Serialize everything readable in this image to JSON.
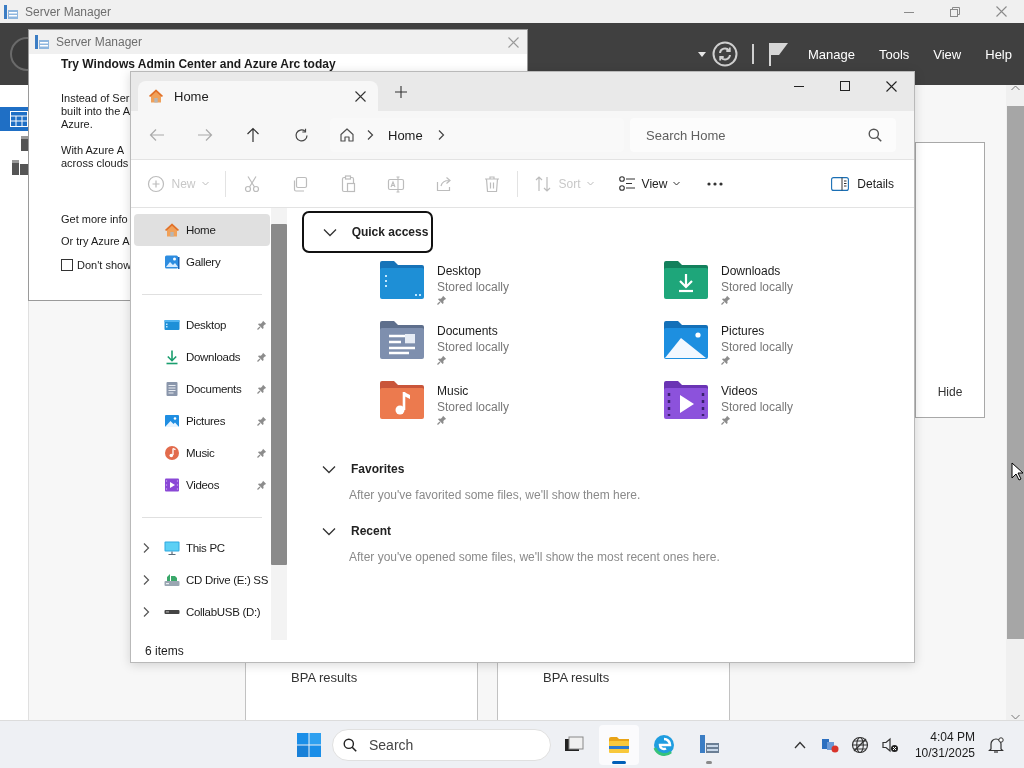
{
  "server_manager": {
    "title": "Server Manager",
    "menu": [
      "Manage",
      "Tools",
      "View",
      "Help"
    ],
    "sidebar": [
      {
        "kind": "dashboard",
        "selected": true
      },
      {
        "kind": "local_server",
        "selected": false
      },
      {
        "kind": "all_servers",
        "selected": false
      }
    ],
    "panel_link": "Hide",
    "tiles": [
      "BPA results",
      "BPA results"
    ]
  },
  "dialog": {
    "title": "Server Manager",
    "heading": "Try Windows Admin Center and Azure Arc today",
    "paragraphs": [
      [
        "Instead of Ser",
        "built into the A",
        "Azure."
      ],
      [
        "With Azure A",
        "across clouds"
      ]
    ],
    "links": [
      "Get more info",
      "Or try Azure A"
    ],
    "checkbox": {
      "label": "Don't show",
      "checked": false
    }
  },
  "explorer": {
    "tabs": [
      {
        "label": "Home",
        "selected": true
      }
    ],
    "breadcrumb": [
      "Home"
    ],
    "search": {
      "placeholder": "Search Home"
    },
    "toolbar": [
      {
        "kind": "new",
        "label": "New",
        "disabled": true
      },
      {
        "kind": "cut",
        "disabled": true
      },
      {
        "kind": "copy",
        "disabled": true
      },
      {
        "kind": "paste",
        "disabled": true
      },
      {
        "kind": "rename",
        "disabled": true
      },
      {
        "kind": "share",
        "disabled": true
      },
      {
        "kind": "delete",
        "disabled": true
      },
      {
        "kind": "sort",
        "label": "Sort",
        "disabled": true
      },
      {
        "kind": "view",
        "label": "View",
        "disabled": false
      },
      {
        "kind": "more",
        "disabled": false
      }
    ],
    "details_button": "Details",
    "nav_groups": [
      [
        {
          "label": "Home",
          "kind": "home",
          "selected": true
        },
        {
          "label": "Gallery",
          "kind": "gallery",
          "selected": false
        }
      ],
      [
        {
          "label": "Desktop",
          "kind": "desktop",
          "pinned": true,
          "selected": false
        },
        {
          "label": "Downloads",
          "kind": "downloads",
          "pinned": true,
          "selected": false
        },
        {
          "label": "Documents",
          "kind": "documents",
          "pinned": true,
          "selected": false
        },
        {
          "label": "Pictures",
          "kind": "pictures",
          "pinned": true,
          "selected": false
        },
        {
          "label": "Music",
          "kind": "music",
          "pinned": true,
          "selected": false
        },
        {
          "label": "Videos",
          "kind": "videos",
          "pinned": true,
          "selected": false
        }
      ],
      [
        {
          "label": "This PC",
          "kind": "pc",
          "expanded": false,
          "selected": false
        },
        {
          "label": "CD Drive (E:) SS",
          "kind": "cd",
          "expanded": false,
          "selected": false
        },
        {
          "label": "CollabUSB (D:)",
          "kind": "usb",
          "expanded": false,
          "selected": false
        }
      ]
    ],
    "sections": [
      {
        "title": "Quick access",
        "expanded": true,
        "focused": true,
        "items": [
          {
            "name": "Desktop",
            "status": "Stored locally",
            "kind": "desktop",
            "pinned": true
          },
          {
            "name": "Downloads",
            "status": "Stored locally",
            "kind": "downloads",
            "pinned": true
          },
          {
            "name": "Documents",
            "status": "Stored locally",
            "kind": "documents",
            "pinned": true
          },
          {
            "name": "Pictures",
            "status": "Stored locally",
            "kind": "pictures",
            "pinned": true
          },
          {
            "name": "Music",
            "status": "Stored locally",
            "kind": "music",
            "pinned": true
          },
          {
            "name": "Videos",
            "status": "Stored locally",
            "kind": "videos",
            "pinned": true
          }
        ]
      },
      {
        "title": "Favorites",
        "expanded": true,
        "focused": false,
        "message": "After you've favorited some files, we'll show them here."
      },
      {
        "title": "Recent",
        "expanded": true,
        "focused": false,
        "message": "After you've opened some files, we'll show the most recent ones here."
      }
    ],
    "status": "6 items"
  },
  "taskbar": {
    "search": {
      "placeholder": "Search"
    },
    "apps": [
      {
        "kind": "task_view",
        "active": false,
        "running": false
      },
      {
        "kind": "explorer",
        "active": true,
        "running": true
      },
      {
        "kind": "edge",
        "active": false,
        "running": false
      },
      {
        "kind": "server_manager",
        "active": false,
        "running": true
      }
    ],
    "time": "4:04 PM",
    "date": "10/31/2025"
  }
}
